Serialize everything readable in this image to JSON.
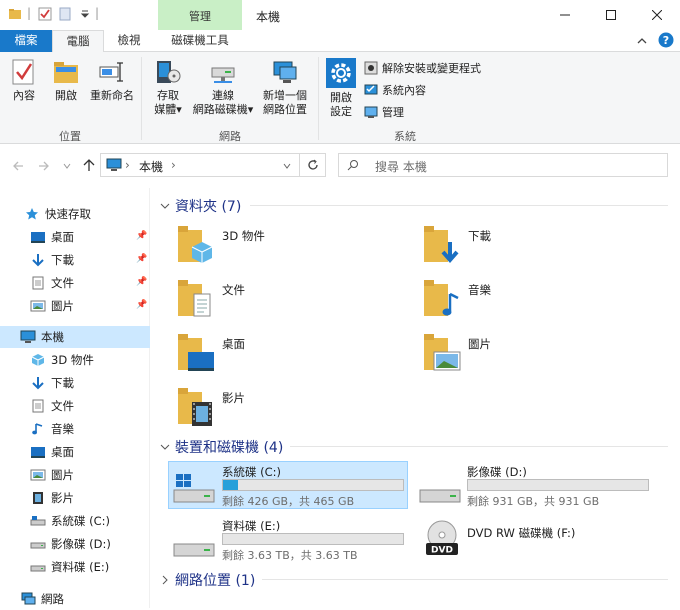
{
  "title_bar": {
    "context_group": "管理",
    "window_title": "本機",
    "qat_separator": "|",
    "min_icon": "minimize-icon",
    "max_icon": "maximize-icon",
    "close_icon": "close-icon"
  },
  "tabs": {
    "file": "檔案",
    "computer": "電腦",
    "view": "檢視",
    "drive_tools": "磁碟機工具"
  },
  "ribbon": {
    "location": {
      "group_label": "位置",
      "properties": "內容",
      "open": "開啟",
      "rename": "重新命名"
    },
    "network": {
      "group_label": "網路",
      "access_media_l1": "存取",
      "access_media_l2": "媒體",
      "map_drive_l1": "連線",
      "map_drive_l2": "網路磁碟機",
      "add_location_l1": "新增一個",
      "add_location_l2": "網路位置"
    },
    "system": {
      "group_label": "系統",
      "open_settings_l1": "開啟",
      "open_settings_l2": "設定",
      "uninstall": "解除安裝或變更程式",
      "system_properties": "系統內容",
      "manage": "管理"
    },
    "dropdown_marker": "▾"
  },
  "address": {
    "path_root": "本機",
    "separator": "›",
    "search_placeholder": "搜尋 本機"
  },
  "nav": {
    "quick_access": "快速存取",
    "qa_items": [
      "桌面",
      "下載",
      "文件",
      "圖片"
    ],
    "this_pc": "本機",
    "pc_items": [
      "3D 物件",
      "下載",
      "文件",
      "音樂",
      "桌面",
      "圖片",
      "影片",
      "系統碟 (C:)",
      "影像碟 (D:)",
      "資料碟 (E:)"
    ],
    "network": "網路"
  },
  "content": {
    "folders_header": "資料夾 (7)",
    "folders": [
      "3D 物件",
      "下載",
      "文件",
      "音樂",
      "桌面",
      "圖片",
      "影片"
    ],
    "devices_header": "裝置和磁碟機 (4)",
    "drives": [
      {
        "name": "系統碟 (C:)",
        "free": "剩餘 426 GB，共 465 GB",
        "used_fraction": 0.084
      },
      {
        "name": "影像碟 (D:)",
        "free": "剩餘 931 GB，共 931 GB",
        "used_fraction": 0.0
      },
      {
        "name": "資料碟 (E:)",
        "free": "剩餘 3.63 TB，共 3.63 TB",
        "used_fraction": 0.0
      }
    ],
    "dvd": {
      "name": "DVD RW 磁碟機 (F:)",
      "badge": "DVD"
    },
    "network_header": "網路位置 (1)"
  },
  "colors": {
    "accent": "#1979ca",
    "selection": "#cce8ff",
    "header_text": "#1e3287",
    "context_tab": "#c9efc6",
    "drive_bar": "#26a0da"
  }
}
